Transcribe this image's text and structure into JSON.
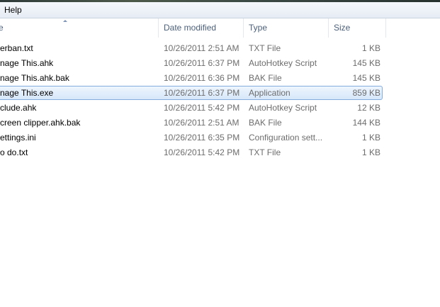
{
  "menubar": {
    "help_label": "Help"
  },
  "columns": {
    "name": "e",
    "date_modified": "Date modified",
    "type": "Type",
    "size": "Size"
  },
  "files": [
    {
      "name": "erban.txt",
      "date": "10/26/2011 2:51 AM",
      "type": "TXT File",
      "size": "1 KB"
    },
    {
      "name": "nage This.ahk",
      "date": "10/26/2011 6:37 PM",
      "type": "AutoHotkey Script",
      "size": "145 KB"
    },
    {
      "name": "nage This.ahk.bak",
      "date": "10/26/2011 6:36 PM",
      "type": "BAK File",
      "size": "145 KB"
    },
    {
      "name": "nage This.exe",
      "date": "10/26/2011 6:37 PM",
      "type": "Application",
      "size": "859 KB"
    },
    {
      "name": "clude.ahk",
      "date": "10/26/2011 5:42 PM",
      "type": "AutoHotkey Script",
      "size": "12 KB"
    },
    {
      "name": "creen clipper.ahk.bak",
      "date": "10/26/2011 2:51 AM",
      "type": "BAK File",
      "size": "144 KB"
    },
    {
      "name": "ettings.ini",
      "date": "10/26/2011 6:35 PM",
      "type": "Configuration sett...",
      "size": "1 KB"
    },
    {
      "name": "o do.txt",
      "date": "10/26/2011 5:42 PM",
      "type": "TXT File",
      "size": "1 KB"
    }
  ],
  "selected_index": 3,
  "colors": {
    "selection_border": "#84acdd",
    "selection_fill": "#d7e7fa",
    "header_text": "#4c607a"
  }
}
